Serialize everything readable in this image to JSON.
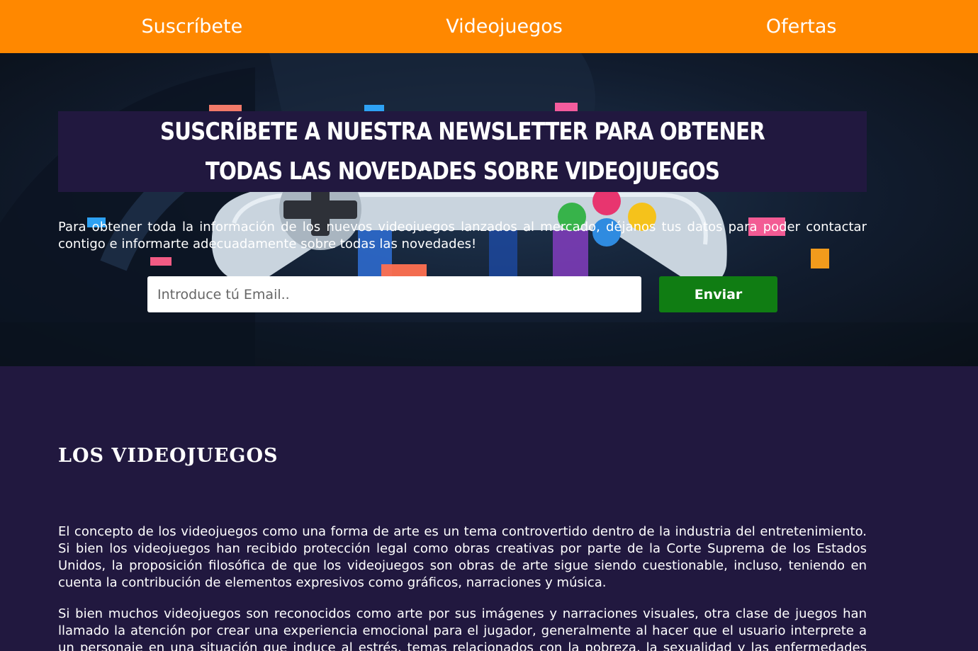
{
  "nav": {
    "items": [
      {
        "label": "Suscríbete"
      },
      {
        "label": "Videojuegos"
      },
      {
        "label": "Ofertas"
      }
    ]
  },
  "hero": {
    "title": "Suscríbete a nuestra newsletter para obtener todas las novedades sobre videojuegos",
    "description": "Para obtener toda la información de los nuevos videojuegos lanzados al mercado, déjanos tus datos para poder contactar contigo e informarte adecuadamente sobre todas las novedades!",
    "email_placeholder": "Introduce tú Email..",
    "email_value": "",
    "submit_label": "Enviar"
  },
  "content": {
    "section_title": "LOS VIDEOJUEGOS",
    "paragraphs": [
      "El concepto de los videojuegos como una forma de arte es un tema controvertido dentro de la industria del entretenimiento. Si bien los videojuegos han recibido protección legal como obras creativas por parte de la Corte Suprema de los Estados Unidos, la proposición filosófica de que los videojuegos son obras de arte sigue siendo cuestionable, incluso, teniendo en cuenta la contribución de elementos expresivos como gráficos, narraciones y música.",
      "Si bien muchos videojuegos son reconocidos como arte por sus imágenes y narraciones visuales, otra clase de juegos han llamado la atención por crear una experiencia emocional para el jugador, generalmente al hacer que el usuario interprete a un personaje en una situación que induce al estrés, temas relacionados con la pobreza, la sexualidad y las enfermedades físicas y"
    ]
  },
  "colors": {
    "nav_bg": "#ff8800",
    "page_bg": "#21183f",
    "button_bg": "#107d13",
    "text": "#ffffff"
  },
  "icons": {
    "hero_image": "game-controller-illustration"
  }
}
